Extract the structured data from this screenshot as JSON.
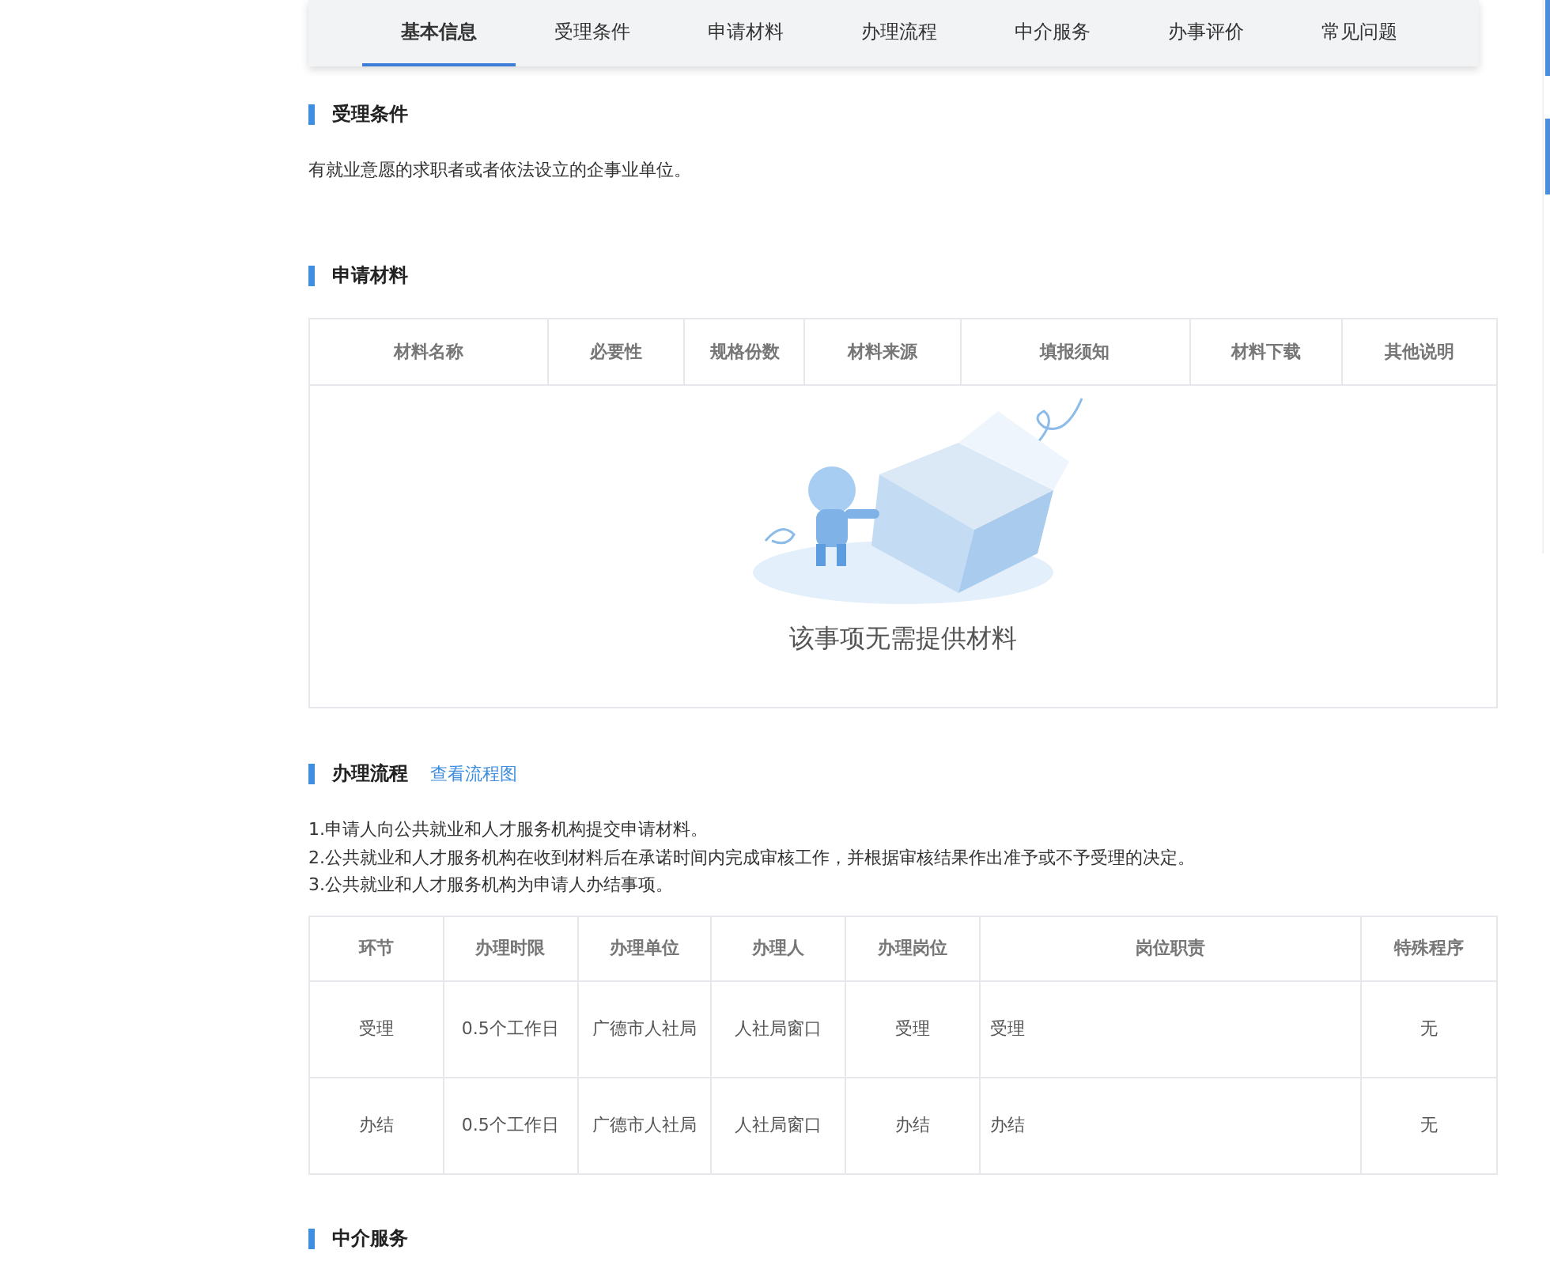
{
  "tabs": [
    {
      "label": "基本信息",
      "selected": true
    },
    {
      "label": "受理条件",
      "selected": false
    },
    {
      "label": "申请材料",
      "selected": false
    },
    {
      "label": "办理流程",
      "selected": false
    },
    {
      "label": "中介服务",
      "selected": false
    },
    {
      "label": "办事评价",
      "selected": false
    },
    {
      "label": "常见问题",
      "selected": false
    }
  ],
  "conditions": {
    "title": "受理条件",
    "text": "有就业意愿的求职者或者依法设立的企事业单位。"
  },
  "materials": {
    "title": "申请材料",
    "columns": [
      "材料名称",
      "必要性",
      "规格份数",
      "材料来源",
      "填报须知",
      "材料下载",
      "其他说明"
    ],
    "empty_text": "该事项无需提供材料"
  },
  "process": {
    "title": "办理流程",
    "link": "查看流程图",
    "steps": [
      "1.申请人向公共就业和人才服务机构提交申请材料。",
      "2.公共就业和人才服务机构在收到材料后在承诺时间内完成审核工作，并根据审核结果作出准予或不予受理的决定。",
      "3.公共就业和人才服务机构为申请人办结事项。"
    ],
    "columns": [
      "环节",
      "办理时限",
      "办理单位",
      "办理人",
      "办理岗位",
      "岗位职责",
      "特殊程序"
    ],
    "rows": [
      [
        "受理",
        "0.5个工作日",
        "广德市人社局",
        "人社局窗口",
        "受理",
        "受理",
        "无"
      ],
      [
        "办结",
        "0.5个工作日",
        "广德市人社局",
        "人社局窗口",
        "办结",
        "办结",
        "无"
      ]
    ]
  },
  "agency": {
    "title": "中介服务"
  }
}
